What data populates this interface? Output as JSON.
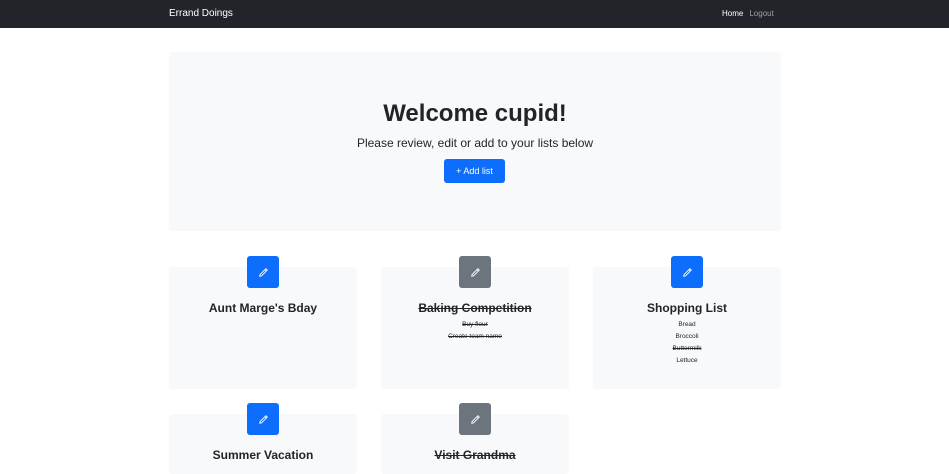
{
  "navbar": {
    "brand": "Errand Doings",
    "links": [
      {
        "label": "Home"
      },
      {
        "label": "Logout"
      }
    ]
  },
  "hero": {
    "title": "Welcome cupid!",
    "subtitle": "Please review, edit or add to your lists below",
    "add_button": "+ Add list"
  },
  "lists": [
    {
      "title": "Aunt Marge's Bday",
      "completed": false,
      "button_color": "#0d6efd",
      "items": []
    },
    {
      "title": "Baking Competition",
      "completed": true,
      "button_color": "#6c757d",
      "items": [
        {
          "text": "Buy flour",
          "done": true
        },
        {
          "text": "Create team name",
          "done": true
        }
      ]
    },
    {
      "title": "Shopping List",
      "completed": false,
      "button_color": "#0d6efd",
      "items": [
        {
          "text": "Bread",
          "done": false
        },
        {
          "text": "Broccoli",
          "done": false
        },
        {
          "text": "Buttermilk",
          "done": true
        },
        {
          "text": "Lettuce",
          "done": false
        }
      ]
    },
    {
      "title": "Summer Vacation",
      "completed": false,
      "button_color": "#0d6efd",
      "items": []
    },
    {
      "title": "Visit Grandma",
      "completed": true,
      "button_color": "#6c757d",
      "items": []
    }
  ],
  "icons": {
    "edit": "pencil-icon"
  }
}
